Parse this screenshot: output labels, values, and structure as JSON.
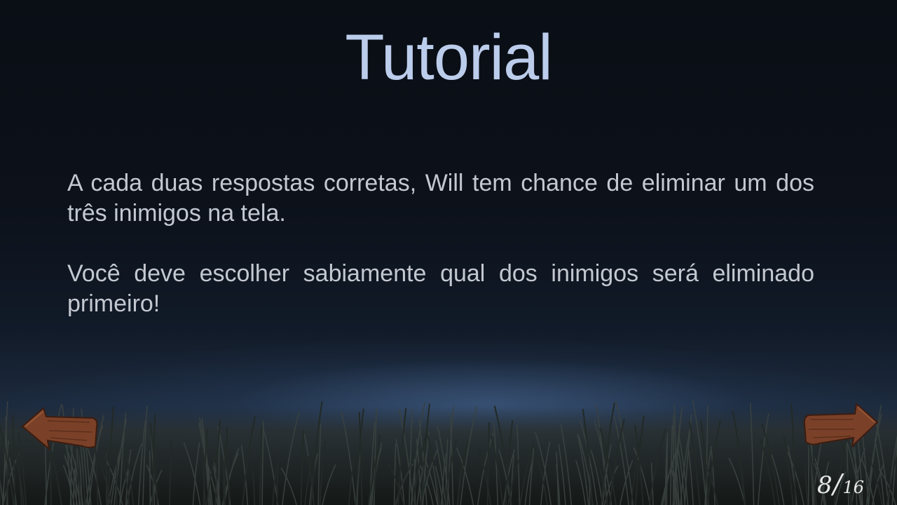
{
  "screen": {
    "title": "Tutorial",
    "paragraphs": [
      "A cada duas respostas corretas, Will tem chance de eliminar um dos três inimigos na tela.",
      "Você deve escolher sabiamente qual dos inimigos será eliminado primeiro!"
    ]
  },
  "navigation": {
    "previous_icon": "wooden-arrow-left-icon",
    "next_icon": "wooden-arrow-right-icon",
    "page_current": "8",
    "page_separator": "/",
    "page_total": "16"
  },
  "colors": {
    "title": "#bccdec",
    "body_text": "#c4c8d0",
    "sky_top": "#0a0e15",
    "horizon_glow": "#4a6890",
    "grass": "#1c2320",
    "arrow_wood": "#7a4128"
  }
}
